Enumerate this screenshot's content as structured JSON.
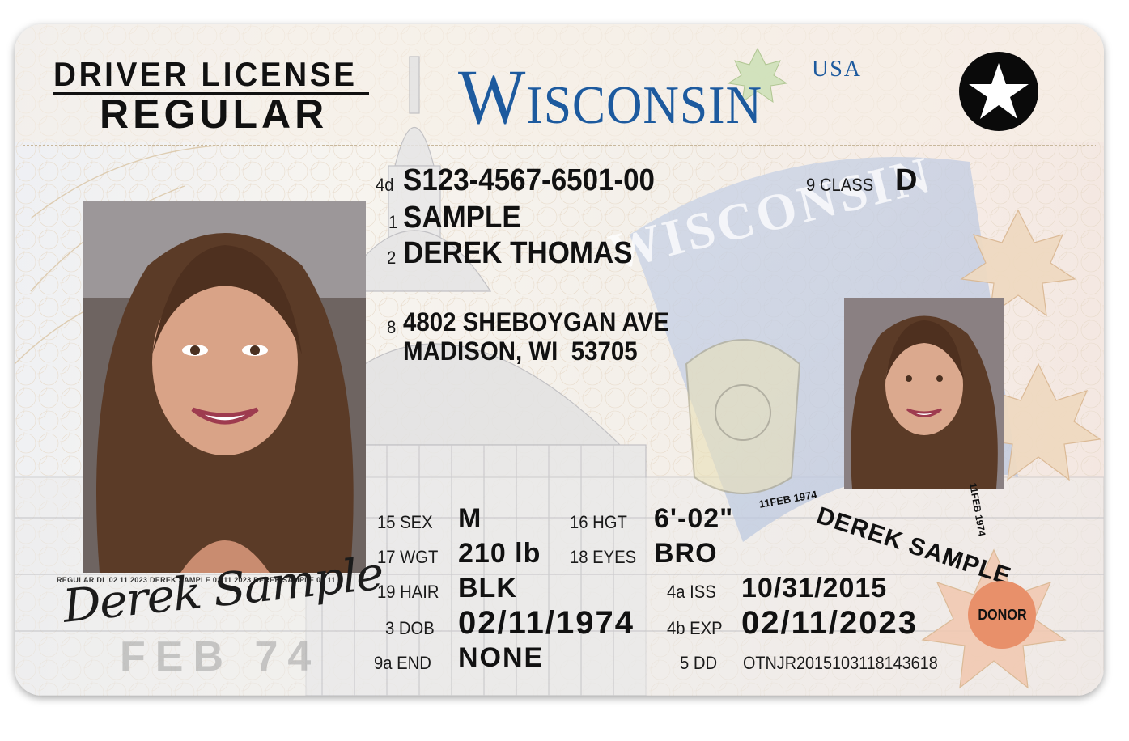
{
  "header": {
    "title_line1": "DRIVER LICENSE",
    "title_line2": "REGULAR",
    "state": "Wisconsin",
    "country": "USA",
    "star_icon": "star-icon"
  },
  "fields": {
    "dl_label": "4d",
    "dl_number": "S123-4567-6501-00",
    "class_label": "9 CLASS",
    "class_value": "D",
    "last_label": "1",
    "last_name": "SAMPLE",
    "first_label": "2",
    "first_name": "DEREK THOMAS",
    "addr_label": "8",
    "address_line1": "4802 SHEBOYGAN AVE",
    "address_line2": "MADISON, WI  53705",
    "sex_label": "15 SEX",
    "sex": "M",
    "hgt_label": "16 HGT",
    "height": "6'-02\"",
    "wgt_label": "17 WGT",
    "weight": "210 lb",
    "eyes_label": "18 EYES",
    "eyes": "BRO",
    "hair_label": "19 HAIR",
    "hair": "BLK",
    "iss_label": "4a ISS",
    "issue_date": "10/31/2015",
    "dob_label": "3 DOB",
    "dob": "02/11/1974",
    "exp_label": "4b EXP",
    "expiration": "02/11/2023",
    "end_label": "9a END",
    "endorsements": "NONE",
    "dd_label": "5 DD",
    "document_discriminator": "OTNJR2015103118143618"
  },
  "security": {
    "flag_text": "WISCONSIN",
    "ghost_dob": "FEB 74",
    "microprint": "REGULAR DL 02 11 2023 DEREK SAMPLE 02 11 2023 DEREK SAMPLE 02 11",
    "arc_small": "11FEB 1974",
    "arc_name": "DEREK SAMPLE",
    "arc_small_right": "11FEB 1974"
  },
  "signature": "Derek Sample",
  "donor": "DONOR",
  "colors": {
    "wisconsin_blue": "#1d5a9e",
    "donor_orange": "#e8906a",
    "text": "#111111"
  }
}
